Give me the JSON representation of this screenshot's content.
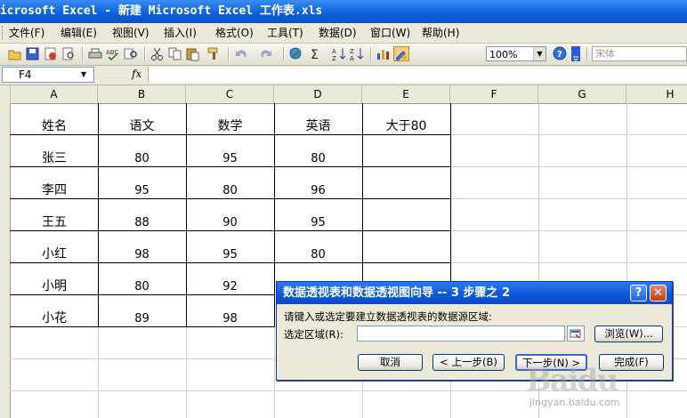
{
  "window": {
    "title": "Microsoft Excel - 新建 Microsoft Excel 工作表.xls"
  },
  "menu": [
    "文件(F)",
    "编辑(E)",
    "视图(V)",
    "插入(I)",
    "格式(O)",
    "工具(T)",
    "数据(D)",
    "窗口(W)",
    "帮助(H)"
  ],
  "toolbar": {
    "zoom": "100%",
    "font": "宋体",
    "icons": [
      "open-icon",
      "save-icon",
      "permission-icon",
      "print-preview-icon",
      "print-icon",
      "spelling-icon",
      "research-icon",
      "cut-icon",
      "copy-icon",
      "paste-icon",
      "format-painter-icon",
      "undo-icon",
      "redo-icon",
      "hyperlink-icon",
      "autosum-icon",
      "sort-ascending-icon",
      "sort-descending-icon",
      "chart-wizard-icon",
      "drawing-icon",
      "help-icon"
    ]
  },
  "formula_bar": {
    "name_box": "F4",
    "fx_label": "fx",
    "value": ""
  },
  "sheet": {
    "columns": [
      "A",
      "B",
      "C",
      "D",
      "E",
      "F",
      "G",
      "H"
    ],
    "header_row": [
      "姓名",
      "语文",
      "数学",
      "英语",
      "大于80"
    ],
    "rows": [
      [
        "张三",
        "80",
        "95",
        "80",
        ""
      ],
      [
        "李四",
        "95",
        "80",
        "96",
        ""
      ],
      [
        "王五",
        "88",
        "90",
        "95",
        ""
      ],
      [
        "小红",
        "98",
        "95",
        "80",
        ""
      ],
      [
        "小明",
        "80",
        "92",
        "",
        ""
      ],
      [
        "小花",
        "89",
        "98",
        "",
        ""
      ]
    ]
  },
  "dialog": {
    "title": "数据透视表和数据透视图向导 -- 3 步骤之 2",
    "help_label": "?",
    "close_label": "✕",
    "prompt": "请键入或选定要建立数据透视表的数据源区域:",
    "range_label": "选定区域(R):",
    "range_value": "",
    "browse": "浏览(W)...",
    "cancel": "取消",
    "back": "< 上一步(B)",
    "next": "下一步(N) >",
    "finish": "完成(F)"
  },
  "watermark": {
    "logo": "Baidu",
    "url": "jingyan.baidu.com"
  }
}
